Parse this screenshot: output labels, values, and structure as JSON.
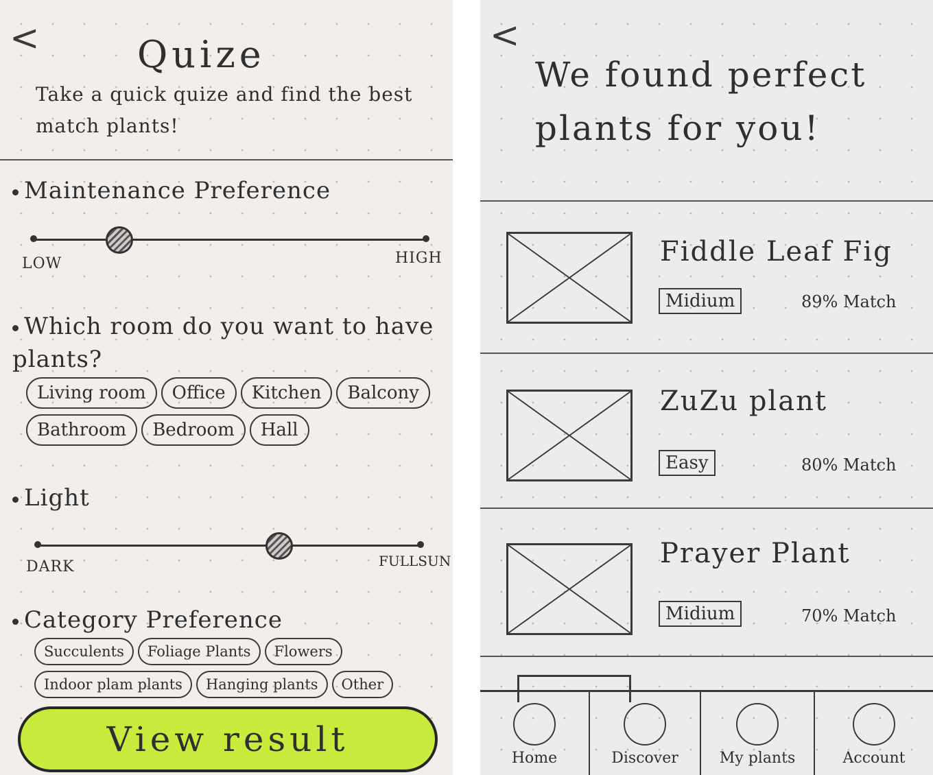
{
  "quiz": {
    "back": "<",
    "title": "Quize",
    "subtitle": "Take a quick quize and find the best match plants!",
    "maintenance": {
      "label": "Maintenance Preference",
      "min_label": "LOW",
      "max_label": "HIGH",
      "value": 0.22
    },
    "room": {
      "label": "Which room do you want to have plants?",
      "options": [
        "Living room",
        "Office",
        "Kitchen",
        "Balcony",
        "Bathroom",
        "Bedroom",
        "Hall"
      ]
    },
    "light": {
      "label": "Light",
      "min_label": "DARK",
      "max_label": "FULLSUN",
      "value": 0.63
    },
    "category": {
      "label": "Category Preference",
      "options": [
        "Succulents",
        "Foliage Plants",
        "Flowers",
        "Indoor plam plants",
        "Hanging plants",
        "Other"
      ]
    },
    "cta": "View result"
  },
  "results": {
    "back": "<",
    "title": "We found perfect plants for you!",
    "items": [
      {
        "name": "Fiddle Leaf Fig",
        "level": "Midium",
        "match": "89% Match"
      },
      {
        "name": "ZuZu plant",
        "level": "Easy",
        "match": "80% Match"
      },
      {
        "name": "Prayer Plant",
        "level": "Midium",
        "match": "70% Match"
      }
    ],
    "tabs": [
      {
        "label": "Home",
        "icon": "home-icon"
      },
      {
        "label": "Discover",
        "icon": "discover-icon"
      },
      {
        "label": "My plants",
        "icon": "my-plants-icon"
      },
      {
        "label": "Account",
        "icon": "account-icon"
      }
    ]
  },
  "colors": {
    "cta_fill": "#c8ec3e",
    "paper": "#f1eeec",
    "ink": "#2f2f2f"
  }
}
